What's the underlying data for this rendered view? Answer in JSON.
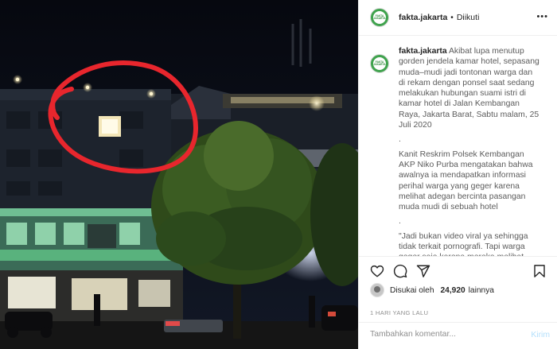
{
  "account": {
    "username": "fakta.jakarta",
    "follow_dot": "•",
    "follow_label": "Diikuti",
    "avatar_text": "FAKTA JAKARTA"
  },
  "header": {
    "more_icon": "more-horizontal-icon",
    "more_glyph": "•••"
  },
  "caption": {
    "username": "fakta.jakarta",
    "paragraphs": [
      "Akibat lupa menutup gorden jendela kamar hotel, sepasang muda–mudi jadi tontonan warga dan di rekam dengan ponsel saat sedang melakukan hubungan suami istri di kamar hotel di Jalan Kembangan Raya, Jakarta Barat, Sabtu malam, 25 Juli 2020",
      ".",
      "Kanit Reskrim Polsek Kembangan AKP Niko Purba mengatakan bahwa awalnya ia mendapatkan informasi perihal warga yang geger karena melihat adegan bercinta pasangan muda mudi di sebuah hotel",
      ".",
      "\"Jadi bukan video viral ya sehingga tidak terkait pornografi. Tapi warga geger saja karena mereka melihat"
    ]
  },
  "actions": {
    "like_icon": "heart-icon",
    "comment_icon": "comment-icon",
    "share_icon": "send-icon",
    "save_icon": "bookmark-icon"
  },
  "likes": {
    "label": "Disukai oleh",
    "count": "24,920",
    "suffix": "lainnya"
  },
  "timestamp": "1 HARI YANG LALU",
  "comment": {
    "placeholder": "Tambahkan komentar...",
    "send_label": "Kirim"
  },
  "colors": {
    "avatar_green": "#3fa34d",
    "send_disabled": "#b2dffc",
    "secondary_text": "#8e8e8e",
    "highlight_circle": "#e8262d"
  }
}
